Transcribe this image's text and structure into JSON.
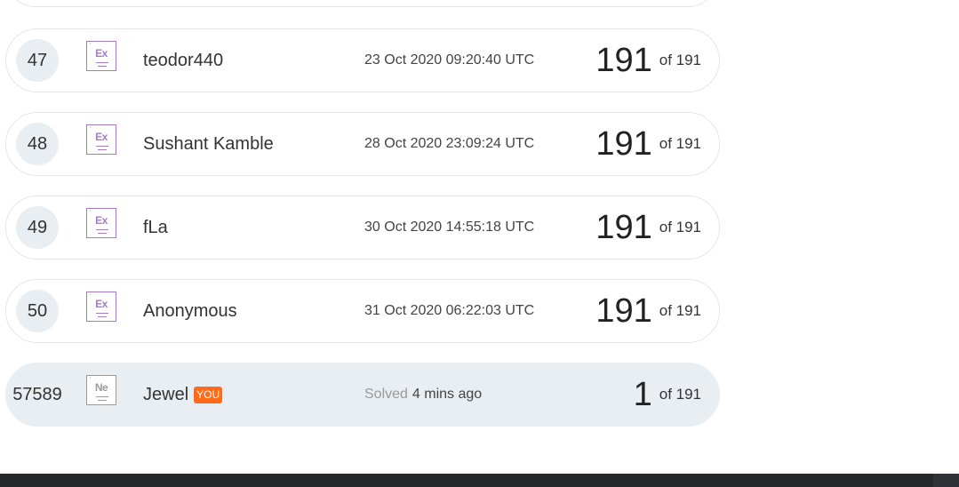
{
  "leaderboard": {
    "rows": [
      {
        "rank": "47",
        "badge": "Ex",
        "name": "teodor440",
        "date": "23 Oct 2020 09:20:40 UTC",
        "score": "191",
        "of": "of 191"
      },
      {
        "rank": "48",
        "badge": "Ex",
        "name": "Sushant Kamble",
        "date": "28 Oct 2020 23:09:24 UTC",
        "score": "191",
        "of": "of 191"
      },
      {
        "rank": "49",
        "badge": "Ex",
        "name": "fLa",
        "date": "30 Oct 2020 14:55:18 UTC",
        "score": "191",
        "of": "of 191"
      },
      {
        "rank": "50",
        "badge": "Ex",
        "name": "Anonymous",
        "date": "31 Oct 2020 06:22:03 UTC",
        "score": "191",
        "of": "of 191"
      }
    ],
    "me": {
      "rank": "57589",
      "badge": "Ne",
      "name": "Jewel",
      "you_label": "YOU",
      "solved_label": "Solved",
      "solved_time": "4 mins ago",
      "score": "1",
      "of": "of 191"
    }
  },
  "colors": {
    "expert_badge": "#a67bc6",
    "novice_badge": "#9a9a9a",
    "you_badge": "#ff6b1a",
    "highlight_row": "#e8eef1"
  }
}
